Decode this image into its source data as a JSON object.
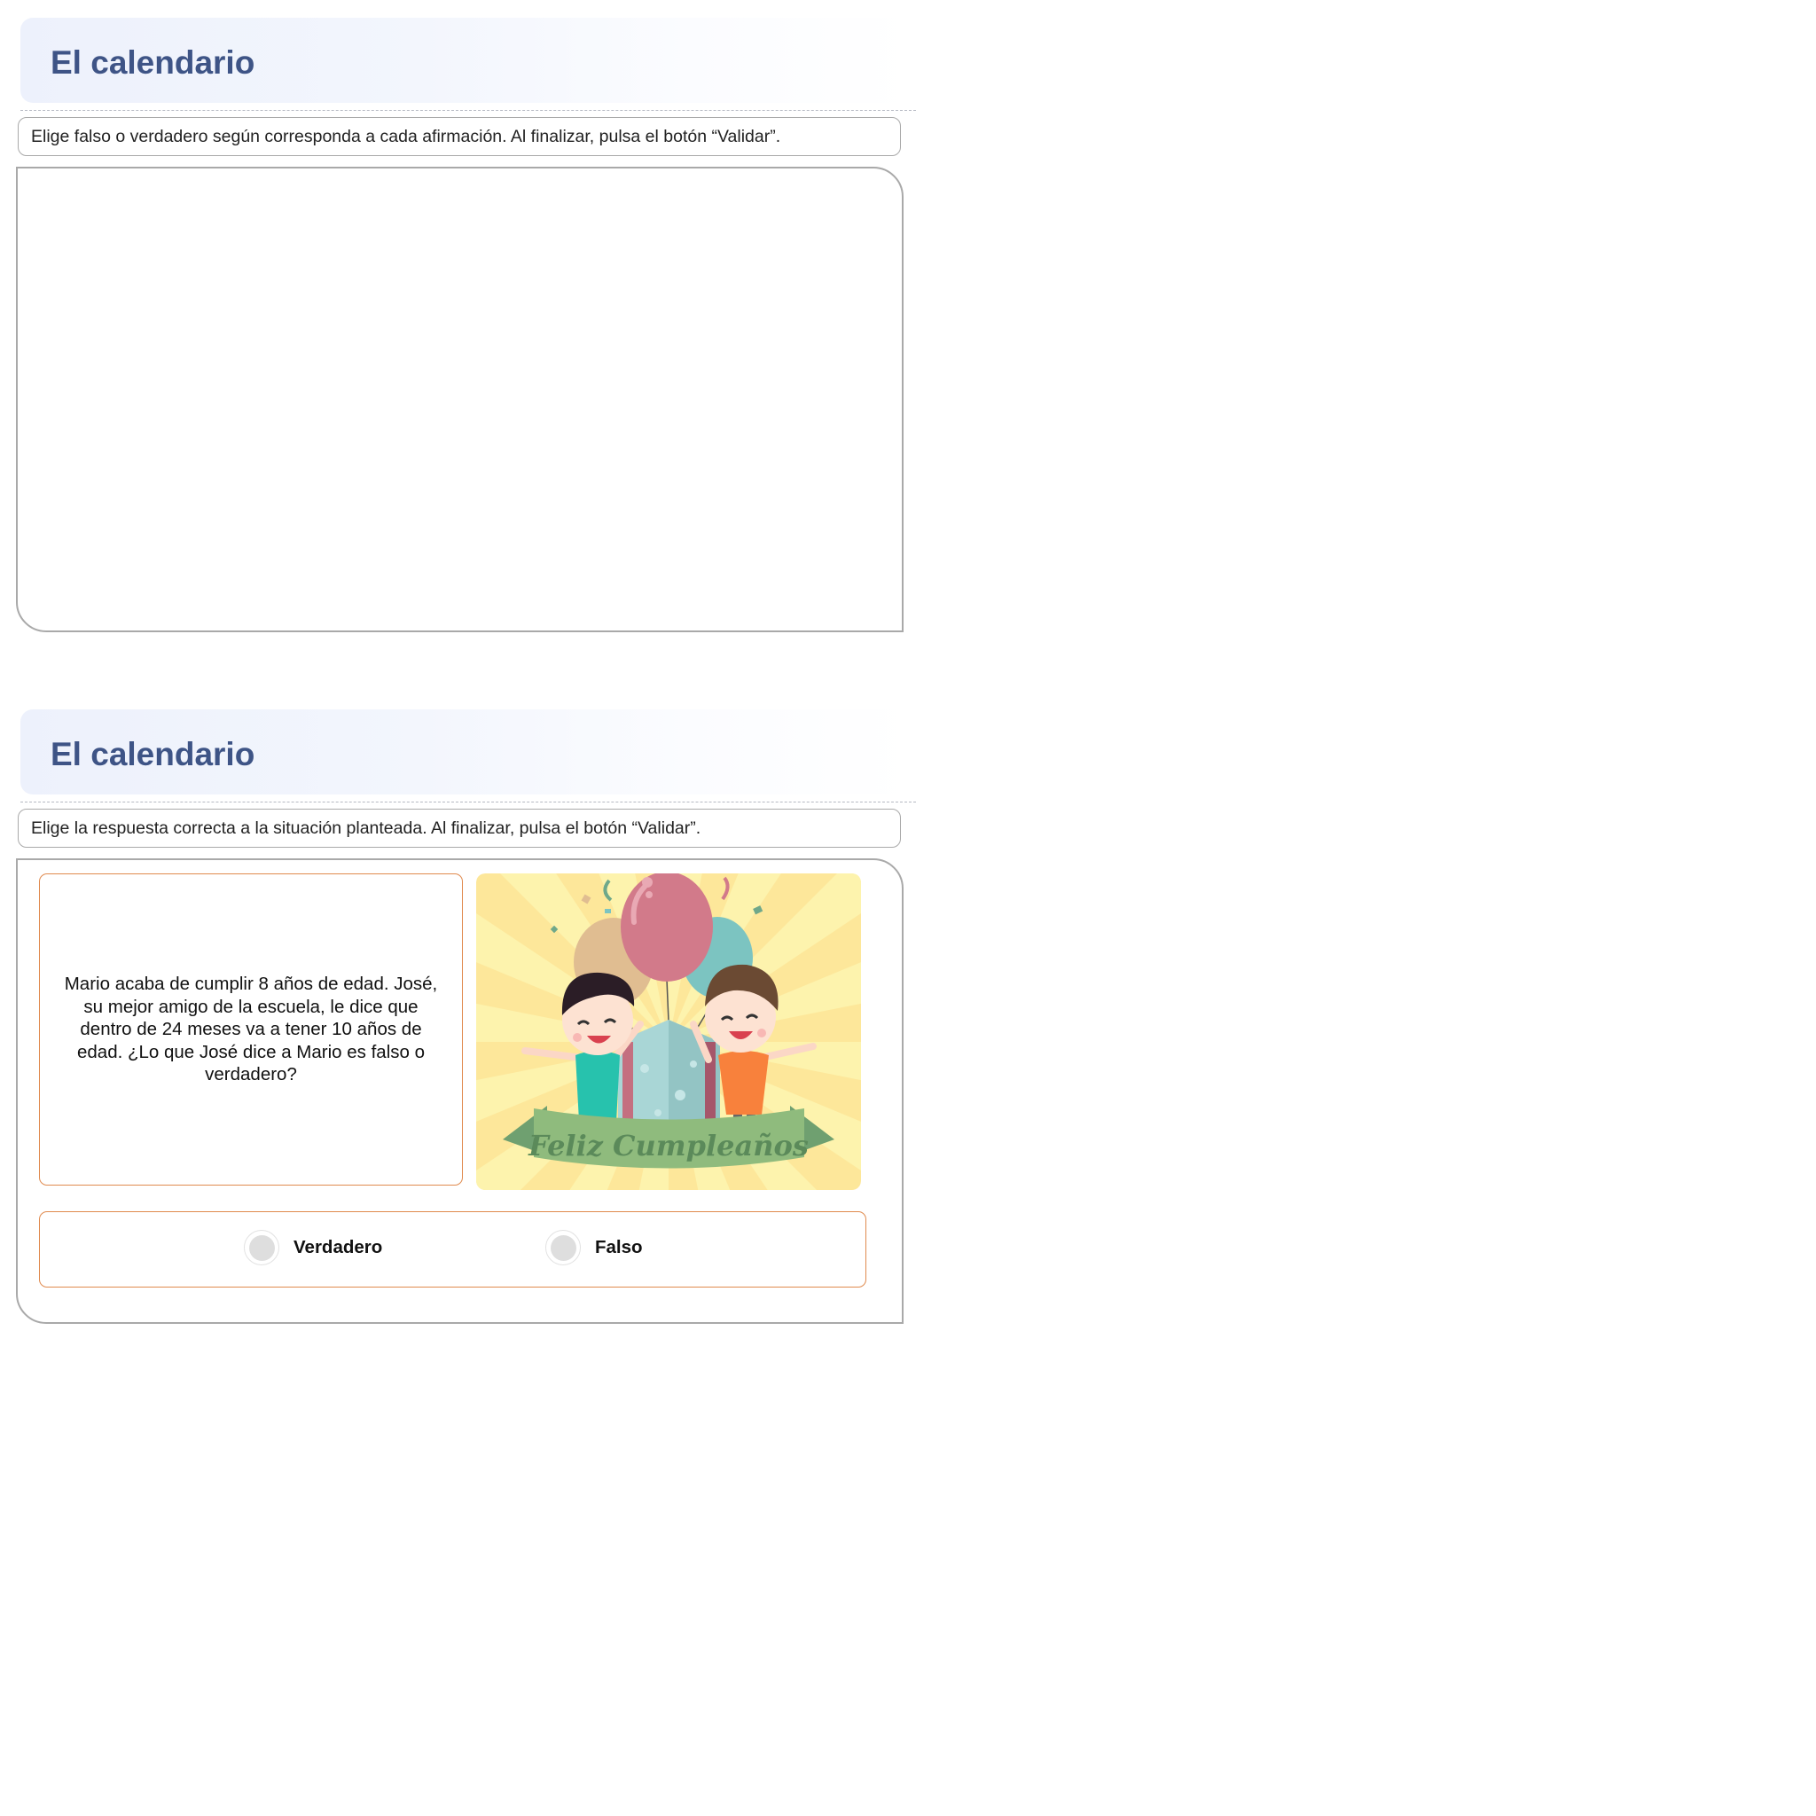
{
  "sections": [
    {
      "title": "El calendario",
      "instruction": "Elige falso o verdadero según corresponda a cada afirmación.  Al finalizar, pulsa el botón “Validar”."
    },
    {
      "title": "El calendario",
      "instruction": "Elige la respuesta correcta a la situación planteada.  Al finalizar, pulsa el botón “Validar”.",
      "question": "Mario acaba de cumplir 8 años de edad. José, su mejor amigo de la escuela, le dice que dentro de 24 meses va a tener 10 años de edad. ¿Lo que José dice a Mario es falso o verdadero?",
      "illustration": {
        "banner_text": "Feliz Cumpleaños",
        "colors": {
          "background": "#fde79a",
          "rays": "#fdf3ad",
          "banner": "#8fbb7d",
          "balloon_pink": "#d27a8a",
          "balloon_teal": "#7cc4c1",
          "balloon_tan": "#e0bd91",
          "gift": "#a9d6d6",
          "gift_ribbon": "#c46f80"
        }
      },
      "options": [
        {
          "label": "Verdadero",
          "selected": false
        },
        {
          "label": "Falso",
          "selected": false
        }
      ]
    }
  ],
  "colors": {
    "title": "#3e5486",
    "accent_border": "#e08a4e",
    "panel_border": "#a9a9a9"
  }
}
